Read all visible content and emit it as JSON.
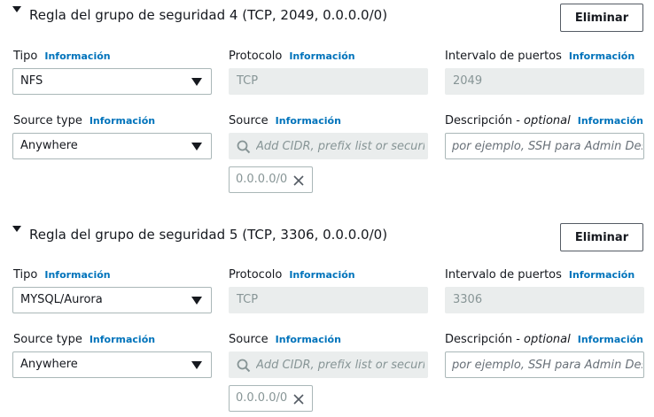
{
  "rules": [
    {
      "title": "Regla del grupo de seguridad 4 (TCP, 2049, 0.0.0.0/0)",
      "delete_label": "Eliminar",
      "tipo_label": "Tipo",
      "tipo_value": "NFS",
      "protocolo_label": "Protocolo",
      "protocolo_value": "TCP",
      "puertos_label": "Intervalo de puertos",
      "puertos_value": "2049",
      "source_type_label": "Source type",
      "source_type_value": "Anywhere",
      "source_label": "Source",
      "source_placeholder": "Add CIDR, prefix list or security group",
      "source_token": "0.0.0.0/0",
      "desc_label": "Descripción - ",
      "desc_optional": "optional",
      "desc_placeholder": "por ejemplo, SSH para Admin Desktop"
    },
    {
      "title": "Regla del grupo de seguridad 5 (TCP, 3306, 0.0.0.0/0)",
      "delete_label": "Eliminar",
      "tipo_label": "Tipo",
      "tipo_value": "MYSQL/Aurora",
      "protocolo_label": "Protocolo",
      "protocolo_value": "TCP",
      "puertos_label": "Intervalo de puertos",
      "puertos_value": "3306",
      "source_type_label": "Source type",
      "source_type_value": "Anywhere",
      "source_label": "Source",
      "source_placeholder": "Add CIDR, prefix list or security group",
      "source_token": "0.0.0.0/0",
      "desc_label": "Descripción - ",
      "desc_optional": "optional",
      "desc_placeholder": "por ejemplo, SSH para Admin Desktop"
    }
  ],
  "info_label": "Información",
  "colors": {
    "link": "#0073bb",
    "disabled_bg": "#eaeded",
    "border": "#aab7b8",
    "text": "#16191f",
    "muted": "#879596"
  },
  "icons": [
    "caret-down-icon",
    "dropdown-arrow-icon",
    "search-icon",
    "remove-token-icon"
  ]
}
